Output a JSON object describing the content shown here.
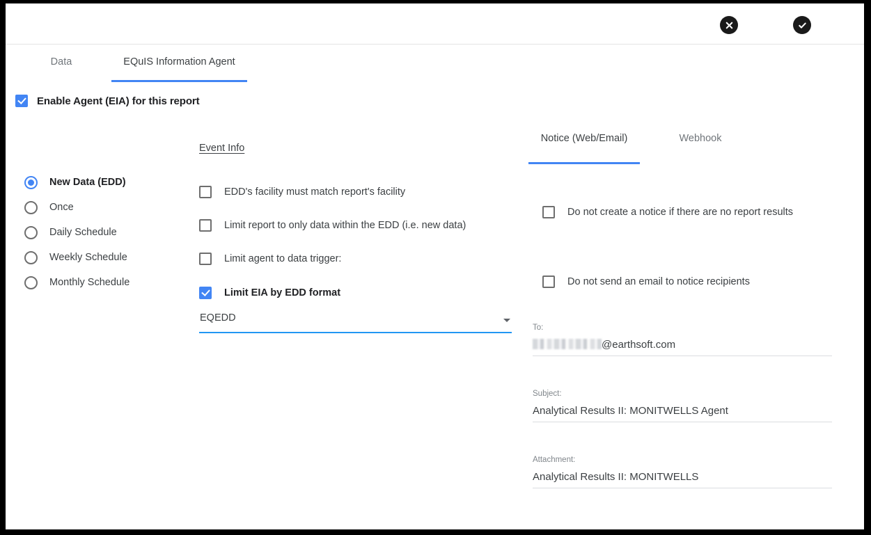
{
  "header": {
    "cancel_icon": "close-circle-icon",
    "confirm_icon": "check-circle-icon"
  },
  "top_tabs": [
    {
      "label": "Data",
      "active": false
    },
    {
      "label": "EQuIS Information Agent",
      "active": true
    }
  ],
  "enable_agent": {
    "label": "Enable Agent (EIA) for this report",
    "checked": true
  },
  "schedule": {
    "options": [
      {
        "label": "New Data (EDD)",
        "selected": true
      },
      {
        "label": "Once",
        "selected": false
      },
      {
        "label": "Daily Schedule",
        "selected": false
      },
      {
        "label": "Weekly Schedule",
        "selected": false
      },
      {
        "label": "Monthly Schedule",
        "selected": false
      }
    ]
  },
  "event_info": {
    "title": "Event Info",
    "checkboxes": [
      {
        "label": "EDD's facility must match report's facility",
        "checked": false
      },
      {
        "label": "Limit report to only data within the EDD (i.e. new data)",
        "checked": false
      },
      {
        "label": "Limit agent to data trigger:",
        "checked": false
      },
      {
        "label": "Limit EIA by EDD format",
        "checked": true
      }
    ],
    "edd_format": {
      "value": "EQEDD",
      "options": [
        "EQEDD"
      ]
    }
  },
  "notice": {
    "tabs": [
      {
        "label": "Notice (Web/Email)",
        "active": true
      },
      {
        "label": "Webhook",
        "active": false
      }
    ],
    "checkboxes": [
      {
        "label": "Do not create a notice if there are no report results",
        "checked": false
      },
      {
        "label": "Do not send an email to notice recipients",
        "checked": false
      }
    ],
    "fields": [
      {
        "label": "To:",
        "value": "@earthsoft.com",
        "redacted_prefix": true
      },
      {
        "label": "Subject:",
        "value": "Analytical Results II: MONITWELLS Agent",
        "redacted_prefix": false
      },
      {
        "label": "Attachment:",
        "value": "Analytical Results II: MONITWELLS",
        "redacted_prefix": false
      }
    ]
  },
  "colors": {
    "accent_blue": "#4285f4",
    "underline_blue": "#2196f3",
    "text_primary": "#3c4043",
    "text_muted": "#80868b",
    "frame_black": "#000000"
  }
}
